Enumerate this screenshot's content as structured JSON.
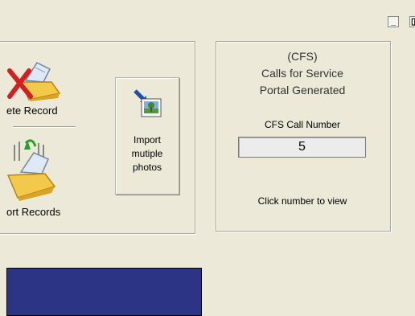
{
  "window_controls": {
    "minimize": "_",
    "restore": "▯"
  },
  "left_panel": {
    "delete_record_label": "ete Record",
    "import_records_label": "ort Records"
  },
  "import_photos": {
    "label_lines": [
      "Import",
      "mutiple",
      "photos"
    ]
  },
  "cfs_panel": {
    "line1": "(CFS)",
    "line2": "Calls for Service",
    "line3": "Portal Generated",
    "call_number_label": "CFS Call Number",
    "call_number_value": "5",
    "hint": "Click number to view"
  },
  "colors": {
    "background": "#ece9d8",
    "blue_panel": "#2b3485",
    "text_gray": "#333333"
  }
}
